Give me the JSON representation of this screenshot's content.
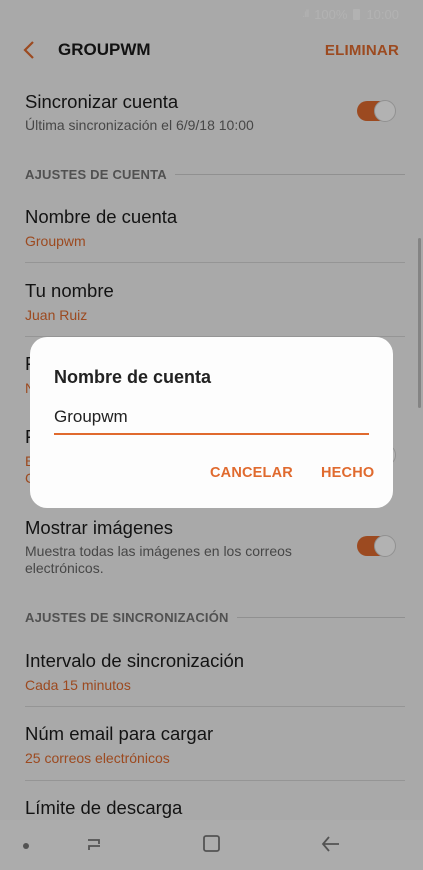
{
  "status": {
    "signal": ".ıll",
    "battery": "100%",
    "time": "10:00"
  },
  "app_bar": {
    "title": "GROUPWM",
    "delete_label": "ELIMINAR"
  },
  "sync_account": {
    "title": "Sincronizar cuenta",
    "subtitle": "Última sincronización el 6/9/18  10:00",
    "enabled": true
  },
  "section_account": "AJUSTES DE CUENTA",
  "account_name": {
    "title": "Nombre de cuenta",
    "value": "Groupwm"
  },
  "your_name": {
    "title": "Tu nombre",
    "value": "Juan Ruiz"
  },
  "hidden_row1": {
    "title": "F",
    "value": "N"
  },
  "hidden_row2": {
    "title": "F",
    "value": "E",
    "value2": "C"
  },
  "show_images": {
    "title": "Mostrar imágenes",
    "subtitle_line1": "Muestra todas las imágenes en los correos",
    "subtitle_line2": "electrónicos.",
    "enabled": true
  },
  "section_sync": "AJUSTES DE SINCRONIZACIÓN",
  "sync_interval": {
    "title": "Intervalo de sincronización",
    "value": "Cada 15 minutos"
  },
  "num_email": {
    "title": "Núm email para cargar",
    "value": "25 correos electrónicos"
  },
  "download_limit": {
    "title": "Límite de descarga"
  },
  "dialog": {
    "title": "Nombre de cuenta",
    "input_value": "Groupwm",
    "cancel_label": "CANCELAR",
    "done_label": "HECHO"
  },
  "colors": {
    "accent": "#e06a2e",
    "background": "#f2f2f2"
  }
}
